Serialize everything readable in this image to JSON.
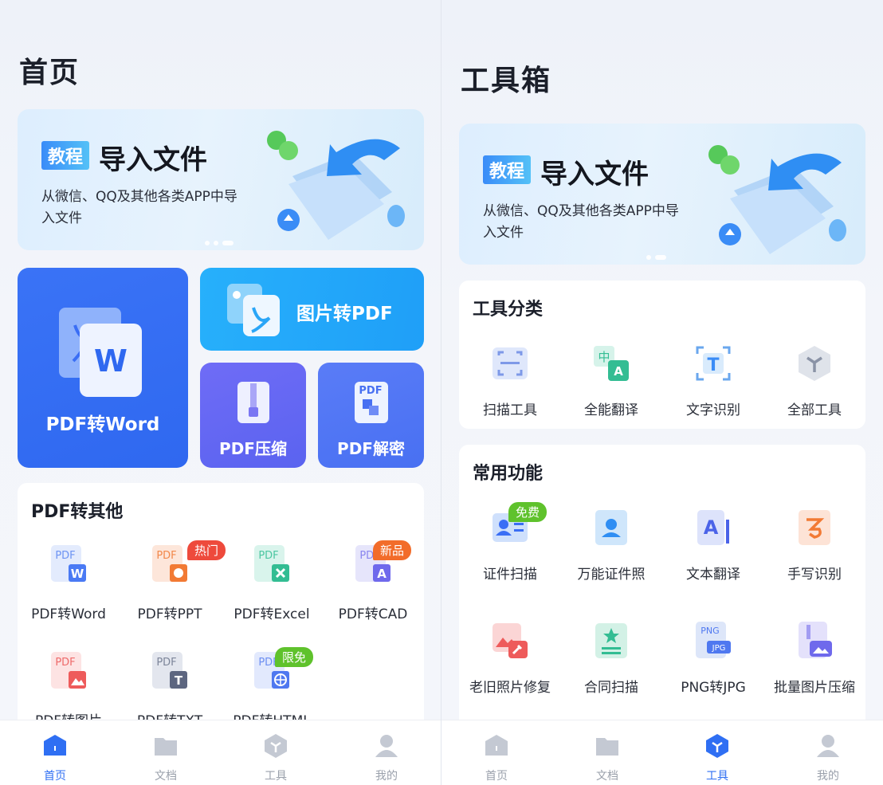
{
  "home": {
    "title": "首页",
    "banner": {
      "tag": "教程",
      "title": "导入文件",
      "subtitle": "从微信、QQ及其他各类APP中导入文件"
    },
    "tiles": {
      "pdf_to_word": "PDF转Word",
      "img_to_pdf": "图片转PDF",
      "pdf_compress": "PDF压缩",
      "pdf_decrypt": "PDF解密"
    },
    "pdf_other": {
      "title": "PDF转其他",
      "items": [
        {
          "label": "PDF转Word",
          "badge": ""
        },
        {
          "label": "PDF转PPT",
          "badge": "热门"
        },
        {
          "label": "PDF转Excel",
          "badge": ""
        },
        {
          "label": "PDF转CAD",
          "badge": "新品"
        },
        {
          "label": "PDF转图片",
          "badge": ""
        },
        {
          "label": "PDF转TXT",
          "badge": ""
        },
        {
          "label": "PDF转HTML",
          "badge": "限免"
        }
      ]
    }
  },
  "tools": {
    "title": "工具箱",
    "banner": {
      "tag": "教程",
      "title": "导入文件",
      "subtitle": "从微信、QQ及其他各类APP中导入文件"
    },
    "categories": {
      "title": "工具分类",
      "items": [
        {
          "label": "扫描工具"
        },
        {
          "label": "全能翻译"
        },
        {
          "label": "文字识别"
        },
        {
          "label": "全部工具"
        }
      ]
    },
    "common": {
      "title": "常用功能",
      "items": [
        {
          "label": "证件扫描",
          "badge": "免费"
        },
        {
          "label": "万能证件照",
          "badge": ""
        },
        {
          "label": "文本翻译",
          "badge": ""
        },
        {
          "label": "手写识别",
          "badge": ""
        },
        {
          "label": "老旧照片修复",
          "badge": ""
        },
        {
          "label": "合同扫描",
          "badge": ""
        },
        {
          "label": "PNG转JPG",
          "badge": ""
        },
        {
          "label": "批量图片压缩",
          "badge": ""
        }
      ]
    }
  },
  "icon_text": {
    "pdf": "PDF",
    "w": "W",
    "a": "A",
    "t": "T",
    "zh": "中",
    "png": "PNG",
    "jpg": "JPG"
  },
  "nav": {
    "home": "首页",
    "docs": "文档",
    "tools": "工具",
    "mine": "我的"
  },
  "colors": {
    "accent": "#2f6ff3",
    "hot": "#ee4a3c",
    "new": "#f26c2a",
    "free": "#5fc22c"
  }
}
